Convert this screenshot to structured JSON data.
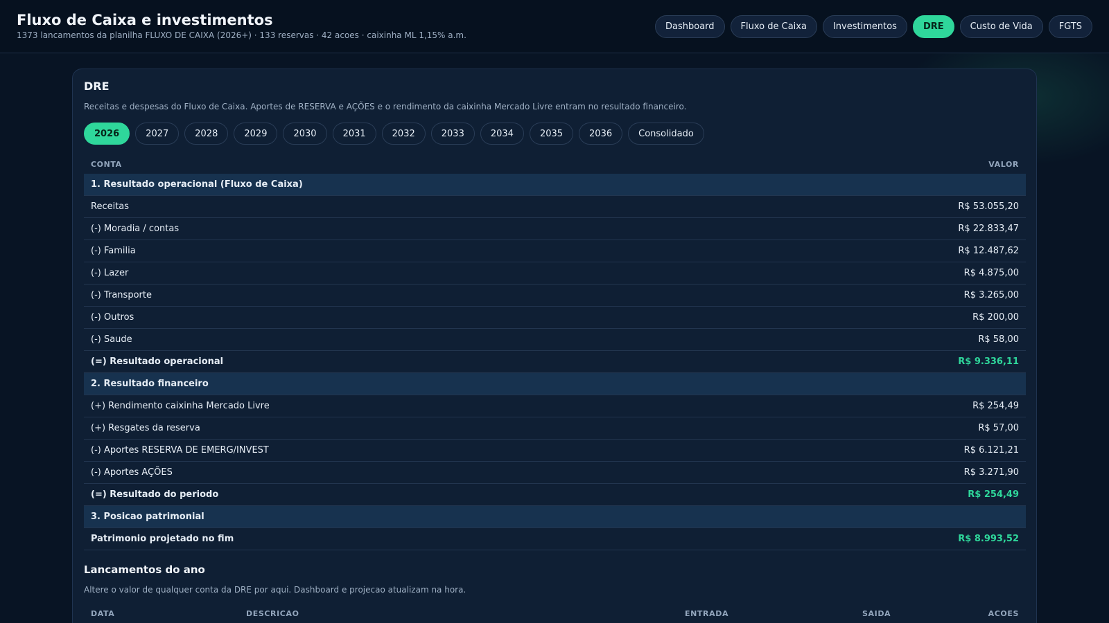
{
  "header": {
    "title": "Fluxo de Caixa e investimentos",
    "subtitle": "1373 lancamentos da planilha FLUXO DE CAIXA (2026+) · 133 reservas · 42 acoes · caixinha ML 1,15% a.m."
  },
  "nav": {
    "items": [
      "Dashboard",
      "Fluxo de Caixa",
      "Investimentos",
      "DRE",
      "Custo de Vida",
      "FGTS"
    ],
    "active": "DRE"
  },
  "dre": {
    "title": "DRE",
    "description": "Receitas e despesas do Fluxo de Caixa. Aportes de RESERVA e AÇÕES e o rendimento da caixinha Mercado Livre entram no resultado financeiro.",
    "years": [
      "2026",
      "2027",
      "2028",
      "2029",
      "2030",
      "2031",
      "2032",
      "2033",
      "2034",
      "2035",
      "2036",
      "Consolidado"
    ],
    "active_year": "2026",
    "columns": {
      "conta": "CONTA",
      "valor": "VALOR"
    },
    "rows": [
      {
        "label": "1. Resultado operacional (Fluxo de Caixa)",
        "value": "",
        "kind": "group"
      },
      {
        "label": "Receitas",
        "value": "R$ 53.055,20",
        "kind": "item"
      },
      {
        "label": "(-) Moradia / contas",
        "value": "R$ 22.833,47",
        "kind": "item"
      },
      {
        "label": "(-) Familia",
        "value": "R$ 12.487,62",
        "kind": "item"
      },
      {
        "label": "(-) Lazer",
        "value": "R$ 4.875,00",
        "kind": "item"
      },
      {
        "label": "(-) Transporte",
        "value": "R$ 3.265,00",
        "kind": "item"
      },
      {
        "label": "(-) Outros",
        "value": "R$ 200,00",
        "kind": "item"
      },
      {
        "label": "(-) Saude",
        "value": "R$ 58,00",
        "kind": "item"
      },
      {
        "label": "(=) Resultado operacional",
        "value": "R$ 9.336,11",
        "kind": "total"
      },
      {
        "label": "2. Resultado financeiro",
        "value": "",
        "kind": "group"
      },
      {
        "label": "(+) Rendimento caixinha Mercado Livre",
        "value": "R$ 254,49",
        "kind": "item"
      },
      {
        "label": "(+) Resgates da reserva",
        "value": "R$ 57,00",
        "kind": "item"
      },
      {
        "label": "(-) Aportes RESERVA DE EMERG/INVEST",
        "value": "R$ 6.121,21",
        "kind": "item"
      },
      {
        "label": "(-) Aportes AÇÕES",
        "value": "R$ 3.271,90",
        "kind": "item"
      },
      {
        "label": "(=) Resultado do periodo",
        "value": "R$ 254,49",
        "kind": "total"
      },
      {
        "label": "3. Posicao patrimonial",
        "value": "",
        "kind": "group"
      },
      {
        "label": "Patrimonio projetado no fim",
        "value": "R$ 8.993,52",
        "kind": "total"
      }
    ]
  },
  "lancamentos": {
    "title": "Lancamentos do ano",
    "description": "Altere o valor de qualquer conta da DRE por aqui. Dashboard e projecao atualizam na hora.",
    "columns": {
      "data": "DATA",
      "descricao": "DESCRICAO",
      "entrada": "ENTRADA",
      "saida": "SAIDA",
      "acoes": "ACOES"
    }
  },
  "colors": {
    "accent": "#2fd79b",
    "background": "#081424",
    "card": "#0f1f34",
    "group_row": "#17324f"
  }
}
